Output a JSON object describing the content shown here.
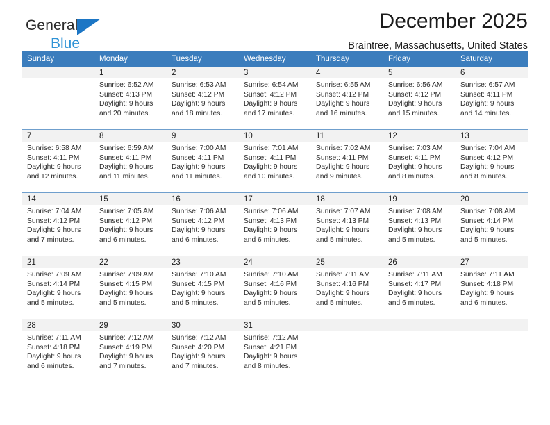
{
  "brand": {
    "name_top": "General",
    "name_bottom": "Blue",
    "triangle_color": "#1c76c5",
    "blue_text_color": "#2f93d6"
  },
  "header": {
    "title": "December 2025",
    "subtitle": "Braintree, Massachusetts, United States"
  },
  "theme": {
    "header_row_bg": "#3b7dbd",
    "header_row_text": "#ffffff",
    "daynum_band_bg": "#f2f2f2",
    "row_divider": "#6f9fcd"
  },
  "weekday_headers": [
    "Sunday",
    "Monday",
    "Tuesday",
    "Wednesday",
    "Thursday",
    "Friday",
    "Saturday"
  ],
  "weeks": [
    [
      {
        "day": "",
        "sunrise": "",
        "sunset": "",
        "daylight_line1": "",
        "daylight_line2": "",
        "empty": true
      },
      {
        "day": "1",
        "sunrise": "Sunrise: 6:52 AM",
        "sunset": "Sunset: 4:13 PM",
        "daylight_line1": "Daylight: 9 hours",
        "daylight_line2": "and 20 minutes."
      },
      {
        "day": "2",
        "sunrise": "Sunrise: 6:53 AM",
        "sunset": "Sunset: 4:12 PM",
        "daylight_line1": "Daylight: 9 hours",
        "daylight_line2": "and 18 minutes."
      },
      {
        "day": "3",
        "sunrise": "Sunrise: 6:54 AM",
        "sunset": "Sunset: 4:12 PM",
        "daylight_line1": "Daylight: 9 hours",
        "daylight_line2": "and 17 minutes."
      },
      {
        "day": "4",
        "sunrise": "Sunrise: 6:55 AM",
        "sunset": "Sunset: 4:12 PM",
        "daylight_line1": "Daylight: 9 hours",
        "daylight_line2": "and 16 minutes."
      },
      {
        "day": "5",
        "sunrise": "Sunrise: 6:56 AM",
        "sunset": "Sunset: 4:12 PM",
        "daylight_line1": "Daylight: 9 hours",
        "daylight_line2": "and 15 minutes."
      },
      {
        "day": "6",
        "sunrise": "Sunrise: 6:57 AM",
        "sunset": "Sunset: 4:11 PM",
        "daylight_line1": "Daylight: 9 hours",
        "daylight_line2": "and 14 minutes."
      }
    ],
    [
      {
        "day": "7",
        "sunrise": "Sunrise: 6:58 AM",
        "sunset": "Sunset: 4:11 PM",
        "daylight_line1": "Daylight: 9 hours",
        "daylight_line2": "and 12 minutes."
      },
      {
        "day": "8",
        "sunrise": "Sunrise: 6:59 AM",
        "sunset": "Sunset: 4:11 PM",
        "daylight_line1": "Daylight: 9 hours",
        "daylight_line2": "and 11 minutes."
      },
      {
        "day": "9",
        "sunrise": "Sunrise: 7:00 AM",
        "sunset": "Sunset: 4:11 PM",
        "daylight_line1": "Daylight: 9 hours",
        "daylight_line2": "and 11 minutes."
      },
      {
        "day": "10",
        "sunrise": "Sunrise: 7:01 AM",
        "sunset": "Sunset: 4:11 PM",
        "daylight_line1": "Daylight: 9 hours",
        "daylight_line2": "and 10 minutes."
      },
      {
        "day": "11",
        "sunrise": "Sunrise: 7:02 AM",
        "sunset": "Sunset: 4:11 PM",
        "daylight_line1": "Daylight: 9 hours",
        "daylight_line2": "and 9 minutes."
      },
      {
        "day": "12",
        "sunrise": "Sunrise: 7:03 AM",
        "sunset": "Sunset: 4:11 PM",
        "daylight_line1": "Daylight: 9 hours",
        "daylight_line2": "and 8 minutes."
      },
      {
        "day": "13",
        "sunrise": "Sunrise: 7:04 AM",
        "sunset": "Sunset: 4:12 PM",
        "daylight_line1": "Daylight: 9 hours",
        "daylight_line2": "and 8 minutes."
      }
    ],
    [
      {
        "day": "14",
        "sunrise": "Sunrise: 7:04 AM",
        "sunset": "Sunset: 4:12 PM",
        "daylight_line1": "Daylight: 9 hours",
        "daylight_line2": "and 7 minutes."
      },
      {
        "day": "15",
        "sunrise": "Sunrise: 7:05 AM",
        "sunset": "Sunset: 4:12 PM",
        "daylight_line1": "Daylight: 9 hours",
        "daylight_line2": "and 6 minutes."
      },
      {
        "day": "16",
        "sunrise": "Sunrise: 7:06 AM",
        "sunset": "Sunset: 4:12 PM",
        "daylight_line1": "Daylight: 9 hours",
        "daylight_line2": "and 6 minutes."
      },
      {
        "day": "17",
        "sunrise": "Sunrise: 7:06 AM",
        "sunset": "Sunset: 4:13 PM",
        "daylight_line1": "Daylight: 9 hours",
        "daylight_line2": "and 6 minutes."
      },
      {
        "day": "18",
        "sunrise": "Sunrise: 7:07 AM",
        "sunset": "Sunset: 4:13 PM",
        "daylight_line1": "Daylight: 9 hours",
        "daylight_line2": "and 5 minutes."
      },
      {
        "day": "19",
        "sunrise": "Sunrise: 7:08 AM",
        "sunset": "Sunset: 4:13 PM",
        "daylight_line1": "Daylight: 9 hours",
        "daylight_line2": "and 5 minutes."
      },
      {
        "day": "20",
        "sunrise": "Sunrise: 7:08 AM",
        "sunset": "Sunset: 4:14 PM",
        "daylight_line1": "Daylight: 9 hours",
        "daylight_line2": "and 5 minutes."
      }
    ],
    [
      {
        "day": "21",
        "sunrise": "Sunrise: 7:09 AM",
        "sunset": "Sunset: 4:14 PM",
        "daylight_line1": "Daylight: 9 hours",
        "daylight_line2": "and 5 minutes."
      },
      {
        "day": "22",
        "sunrise": "Sunrise: 7:09 AM",
        "sunset": "Sunset: 4:15 PM",
        "daylight_line1": "Daylight: 9 hours",
        "daylight_line2": "and 5 minutes."
      },
      {
        "day": "23",
        "sunrise": "Sunrise: 7:10 AM",
        "sunset": "Sunset: 4:15 PM",
        "daylight_line1": "Daylight: 9 hours",
        "daylight_line2": "and 5 minutes."
      },
      {
        "day": "24",
        "sunrise": "Sunrise: 7:10 AM",
        "sunset": "Sunset: 4:16 PM",
        "daylight_line1": "Daylight: 9 hours",
        "daylight_line2": "and 5 minutes."
      },
      {
        "day": "25",
        "sunrise": "Sunrise: 7:11 AM",
        "sunset": "Sunset: 4:16 PM",
        "daylight_line1": "Daylight: 9 hours",
        "daylight_line2": "and 5 minutes."
      },
      {
        "day": "26",
        "sunrise": "Sunrise: 7:11 AM",
        "sunset": "Sunset: 4:17 PM",
        "daylight_line1": "Daylight: 9 hours",
        "daylight_line2": "and 6 minutes."
      },
      {
        "day": "27",
        "sunrise": "Sunrise: 7:11 AM",
        "sunset": "Sunset: 4:18 PM",
        "daylight_line1": "Daylight: 9 hours",
        "daylight_line2": "and 6 minutes."
      }
    ],
    [
      {
        "day": "28",
        "sunrise": "Sunrise: 7:11 AM",
        "sunset": "Sunset: 4:18 PM",
        "daylight_line1": "Daylight: 9 hours",
        "daylight_line2": "and 6 minutes."
      },
      {
        "day": "29",
        "sunrise": "Sunrise: 7:12 AM",
        "sunset": "Sunset: 4:19 PM",
        "daylight_line1": "Daylight: 9 hours",
        "daylight_line2": "and 7 minutes."
      },
      {
        "day": "30",
        "sunrise": "Sunrise: 7:12 AM",
        "sunset": "Sunset: 4:20 PM",
        "daylight_line1": "Daylight: 9 hours",
        "daylight_line2": "and 7 minutes."
      },
      {
        "day": "31",
        "sunrise": "Sunrise: 7:12 AM",
        "sunset": "Sunset: 4:21 PM",
        "daylight_line1": "Daylight: 9 hours",
        "daylight_line2": "and 8 minutes."
      },
      {
        "day": "",
        "sunrise": "",
        "sunset": "",
        "daylight_line1": "",
        "daylight_line2": "",
        "empty": true
      },
      {
        "day": "",
        "sunrise": "",
        "sunset": "",
        "daylight_line1": "",
        "daylight_line2": "",
        "empty": true
      },
      {
        "day": "",
        "sunrise": "",
        "sunset": "",
        "daylight_line1": "",
        "daylight_line2": "",
        "empty": true
      }
    ]
  ]
}
